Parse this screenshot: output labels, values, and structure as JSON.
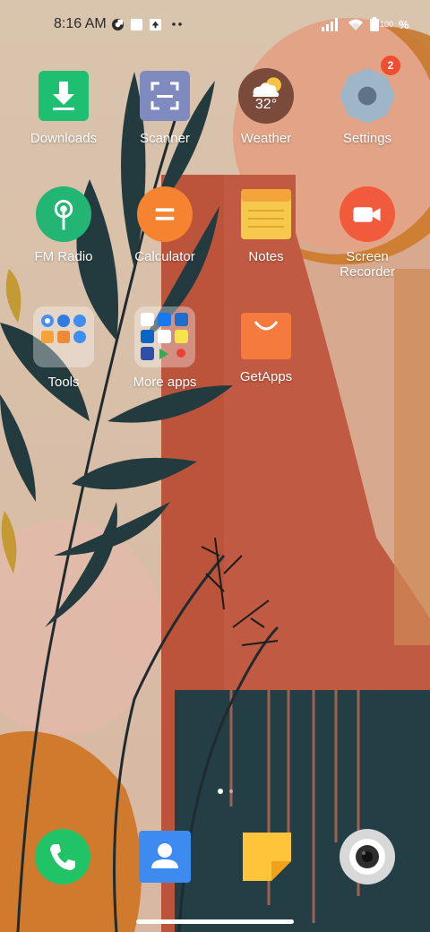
{
  "status_bar": {
    "time": "8:16 AM",
    "battery_level": "100",
    "battery_suffix": "%",
    "icons": [
      "vpn-key-icon",
      "square-notification-icon",
      "upload-notification-icon",
      "more-dots-icon",
      "signal-icon",
      "wifi-icon",
      "battery-icon"
    ]
  },
  "apps": [
    {
      "label": "Downloads",
      "icon": "download-icon"
    },
    {
      "label": "Scanner",
      "icon": "scanner-icon"
    },
    {
      "label": "Weather",
      "icon": "weather-icon",
      "temperature": "32°"
    },
    {
      "label": "Settings",
      "icon": "gear-icon",
      "badge": "2"
    },
    {
      "label": "FM Radio",
      "icon": "radio-icon"
    },
    {
      "label": "Calculator",
      "icon": "calculator-icon"
    },
    {
      "label": "Notes",
      "icon": "notes-icon"
    },
    {
      "label": "Screen\nRecorder",
      "label_line1": "Screen",
      "label_line2": "Recorder",
      "icon": "video-camera-icon"
    },
    {
      "label": "Tools",
      "icon": "folder-icon"
    },
    {
      "label": "More apps",
      "icon": "folder-icon"
    },
    {
      "label": "GetApps",
      "icon": "shopping-bag-icon"
    }
  ],
  "dock": [
    {
      "name": "Phone",
      "icon": "phone-icon"
    },
    {
      "name": "Contacts",
      "icon": "contacts-icon"
    },
    {
      "name": "Notes",
      "icon": "note-icon"
    },
    {
      "name": "Camera",
      "icon": "camera-icon"
    }
  ],
  "page_indicator": {
    "pages": 2,
    "current": 1
  },
  "colors": {
    "downloads": "#1fbf72",
    "scanner": "#7f8bbf",
    "weather_bg": "#7a4a3a",
    "settings": "#9fb6c9",
    "fm_radio": "#22b573",
    "calculator": "#f5832f",
    "notes": "#f6c84d",
    "recorder": "#f25a3c",
    "getapps": "#f47a3e",
    "phone": "#20c466",
    "contacts": "#3d8af0",
    "badge": "#ef4e30"
  }
}
